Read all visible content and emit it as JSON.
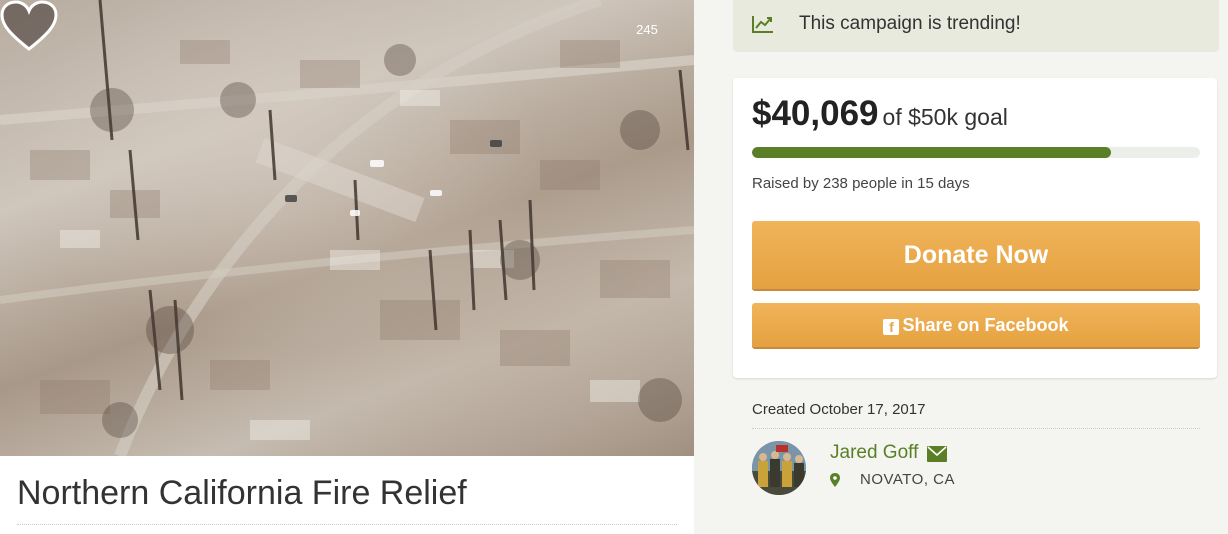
{
  "campaign": {
    "title": "Northern California Fire Relief",
    "hearts_count": "245"
  },
  "trending": {
    "text": "This campaign is trending!",
    "icon": "trending-chart-icon"
  },
  "donation": {
    "raised": "$40,069",
    "goal_text": "of $50k goal",
    "progress_fraction": 0.80138,
    "raised_by": "Raised by 238 people in 15 days",
    "donate_label": "Donate Now",
    "share_label": "Share on Facebook"
  },
  "organizer": {
    "created": "Created October 17, 2017",
    "name": "Jared Goff",
    "location": "NOVATO, CA"
  },
  "colors": {
    "accent_green": "#5a7f26",
    "button_orange": "#e9a74a",
    "trend_bg": "#e7eadc"
  }
}
